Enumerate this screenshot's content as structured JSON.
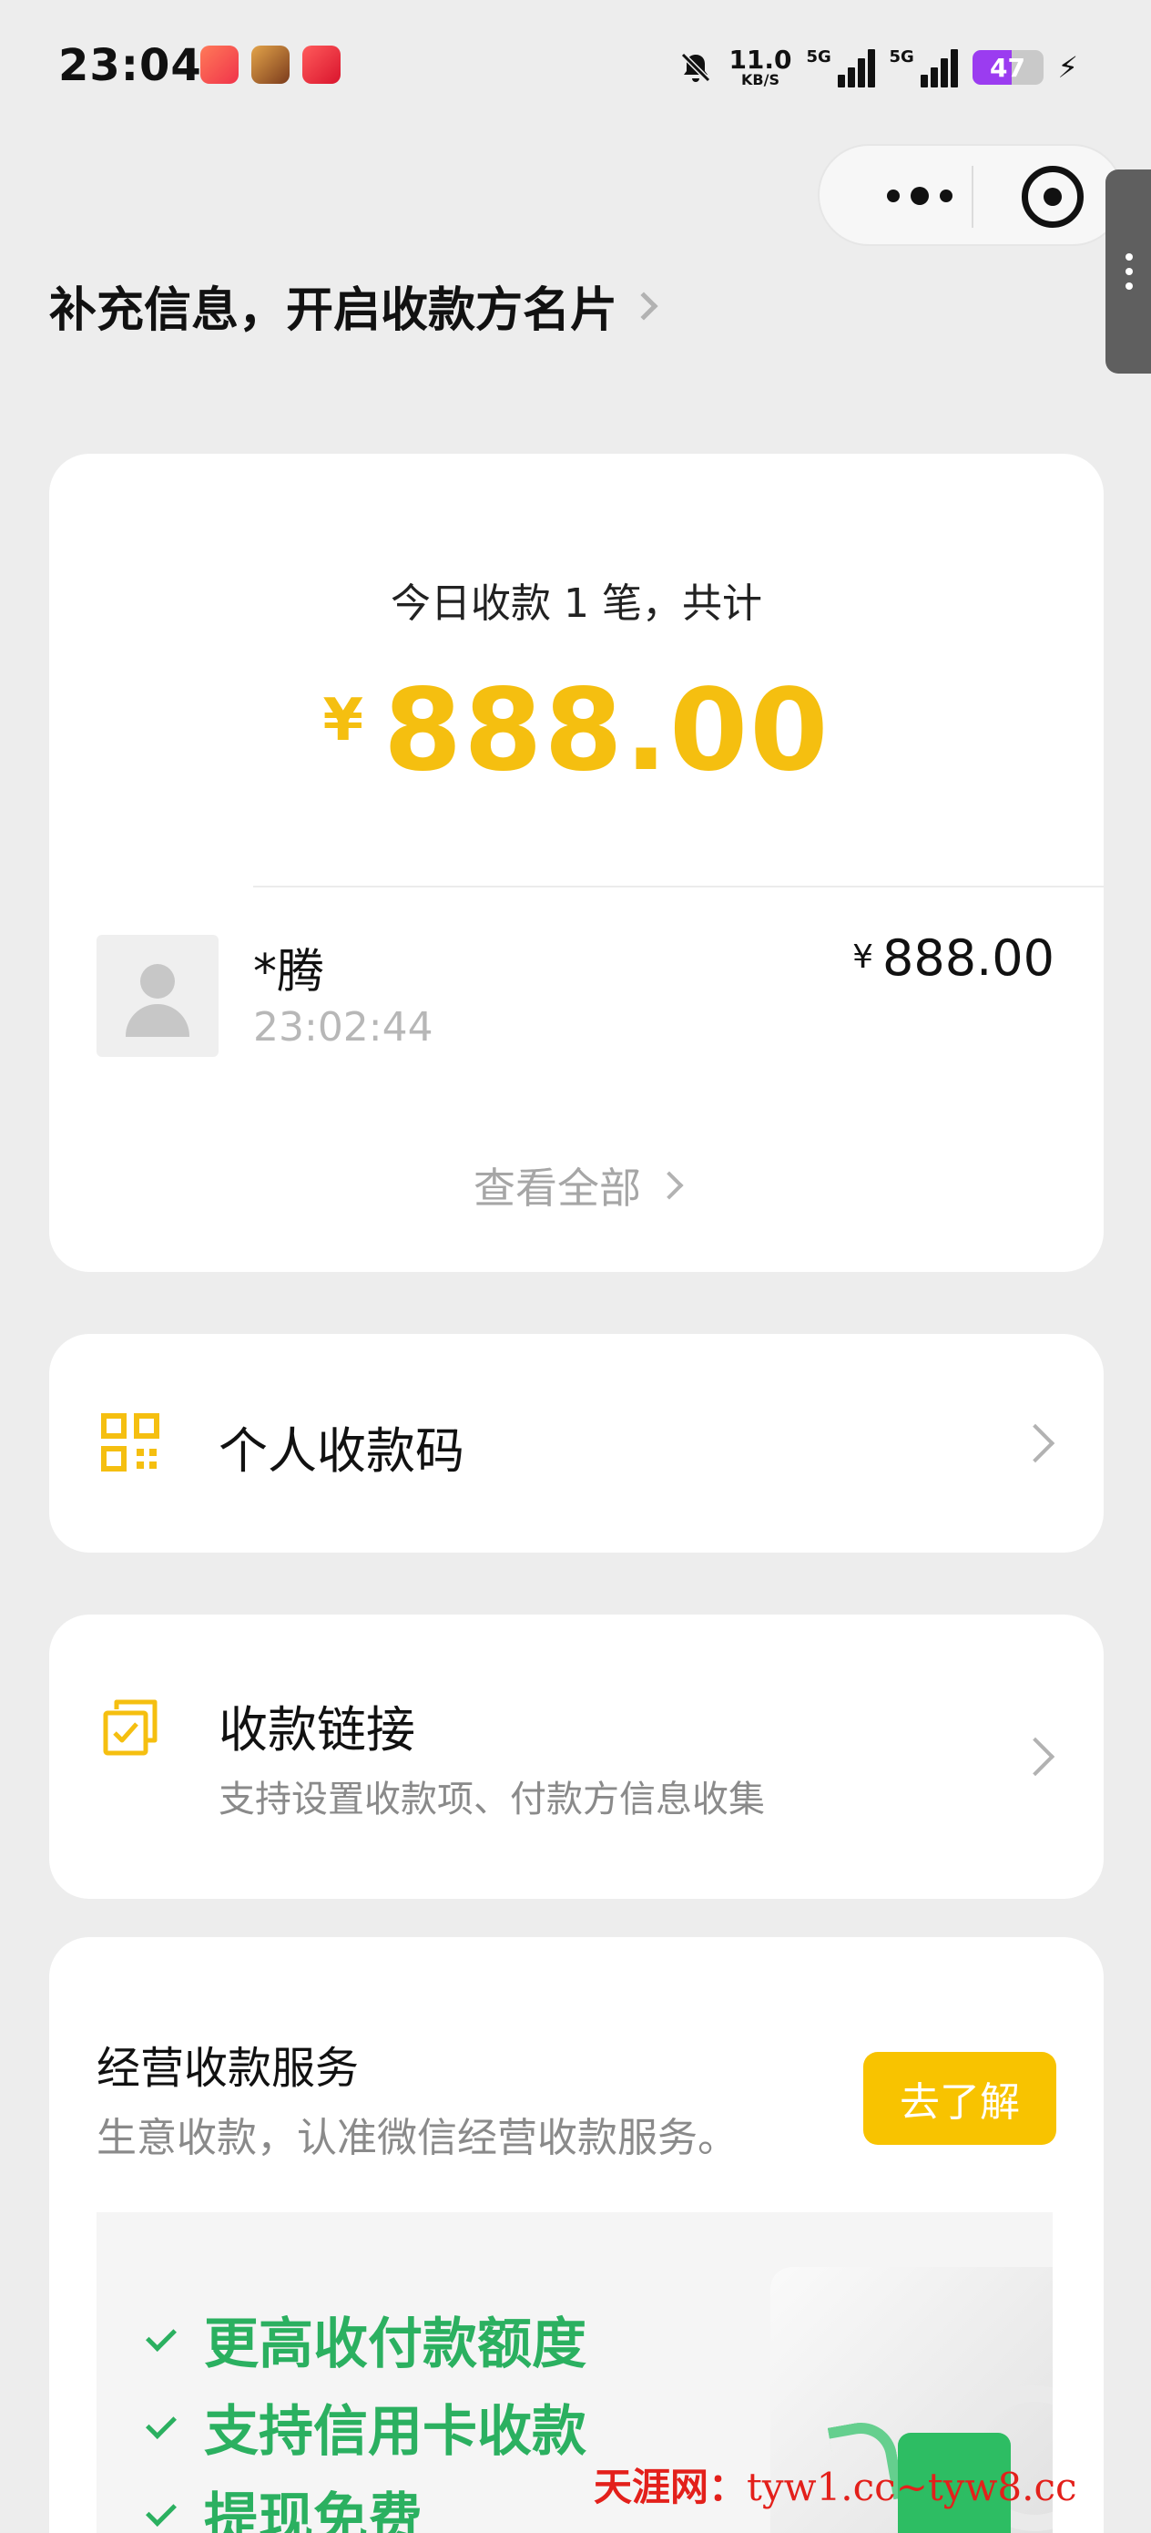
{
  "status_bar": {
    "time": "23:04",
    "net_speed_value": "11.0",
    "net_speed_unit": "KB/S",
    "signal_1_label": "5G",
    "signal_2_label": "5G",
    "battery": "47",
    "icons": [
      "notifications-muted-icon",
      "signal-icon",
      "battery-icon",
      "charging-icon"
    ]
  },
  "capsule": {
    "more_icon": "more-dots-icon",
    "close_icon": "target-close-icon"
  },
  "header": {
    "link_text": "补充信息，开启收款方名片"
  },
  "summary": {
    "title": "今日收款 1 笔，共计",
    "currency": "¥",
    "amount": "888.00",
    "transaction": {
      "name": "*腾",
      "time": "23:02:44",
      "currency": "¥",
      "amount": "888.00"
    },
    "view_all": "查看全部"
  },
  "personal_qr": {
    "label": "个人收款码",
    "icon": "qr-code-icon"
  },
  "payment_link": {
    "label": "收款链接",
    "subtitle": "支持设置收款项、付款方信息收集",
    "icon": "link-check-icon"
  },
  "business_service": {
    "title": "经营收款服务",
    "subtitle": "生意收款，认准微信经营收款服务。",
    "button": "去了解",
    "features": [
      "更高收付款额度",
      "支持信用卡收款",
      "提现免费"
    ]
  },
  "watermark": {
    "site": "天涯网：",
    "url": "tyw1.cc~tyw8.cc"
  },
  "colors": {
    "background": "#ededed",
    "accent_yellow": "#f5bf10",
    "button_yellow": "#f8c300",
    "green": "#2bb060",
    "watermark_red": "#e3201b"
  }
}
